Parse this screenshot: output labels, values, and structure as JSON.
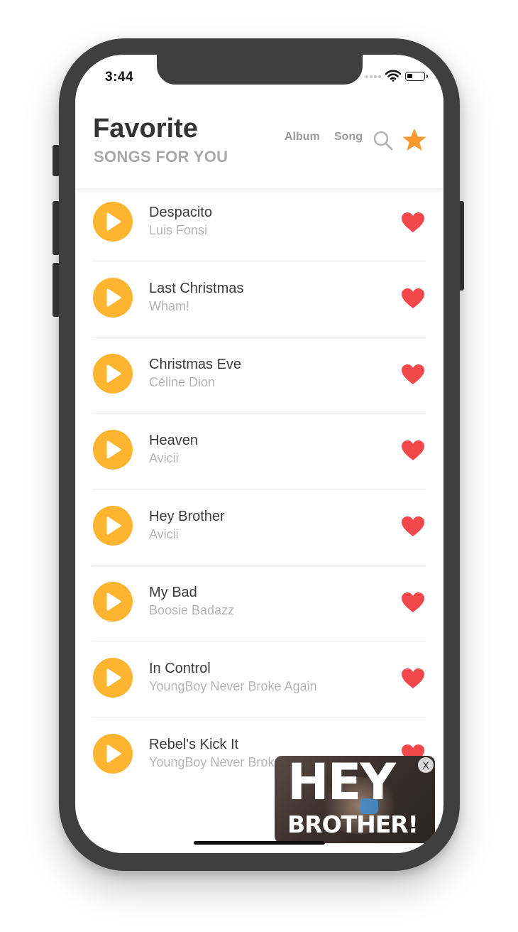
{
  "status_bar": {
    "time": "3:44"
  },
  "header": {
    "title": "Favorite",
    "subtitle": "SONGS FOR YOU",
    "nav": {
      "album": "Album",
      "song": "Song"
    },
    "icons": [
      "search-icon",
      "star-icon"
    ]
  },
  "colors": {
    "accent": "#fdb531",
    "heart": "#f2484c",
    "star": "#fb9a2c",
    "title": "#333333",
    "muted": "#a9a9a9"
  },
  "songs": [
    {
      "title": "Despacito",
      "artist": "Luis Fonsi"
    },
    {
      "title": "Last Christmas",
      "artist": "Wham!"
    },
    {
      "title": "Christmas Eve",
      "artist": "Céline Dion"
    },
    {
      "title": "Heaven",
      "artist": "Avicii"
    },
    {
      "title": "Hey Brother",
      "artist": "Avicii"
    },
    {
      "title": "My Bad",
      "artist": "Boosie Badazz"
    },
    {
      "title": "In Control",
      "artist": "YoungBoy Never Broke Again"
    },
    {
      "title": "Rebel's Kick It",
      "artist": "YoungBoy Never Broke Again"
    }
  ],
  "mini_player": {
    "artwork_line1": "HEY",
    "artwork_line2": "BROTHER!",
    "close_label": "X"
  }
}
